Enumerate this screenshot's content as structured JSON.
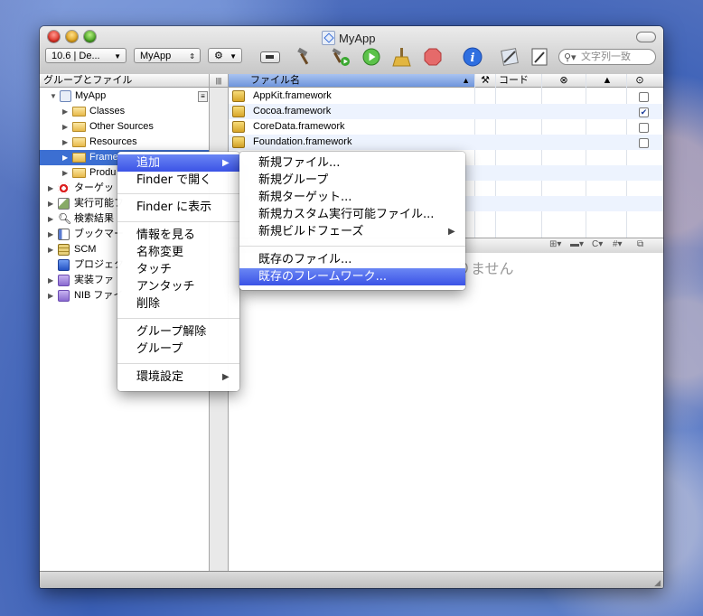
{
  "window": {
    "title": "MyApp"
  },
  "toolbar": {
    "sdk_popup": "10.6 | De...",
    "target_popup": "MyApp",
    "search_placeholder": "文字列一致"
  },
  "left_pane": {
    "header": "グループとファイル",
    "tree": [
      {
        "label": "MyApp"
      },
      {
        "label": "Classes"
      },
      {
        "label": "Other Sources"
      },
      {
        "label": "Resources"
      },
      {
        "label": "Frame"
      },
      {
        "label": "Produ"
      },
      {
        "label": "ターゲッ"
      },
      {
        "label": "実行可能フ"
      },
      {
        "label": "検索結果"
      },
      {
        "label": "ブックマー"
      },
      {
        "label": "SCM"
      },
      {
        "label": "プロジェク"
      },
      {
        "label": "実装ファ"
      },
      {
        "label": "NIB ファイ"
      }
    ]
  },
  "file_list": {
    "col_name": "ファイル名",
    "col_code": "コード",
    "files": [
      {
        "name": "AppKit.framework",
        "checked": false
      },
      {
        "name": "Cocoa.framework",
        "checked": true
      },
      {
        "name": "CoreData.framework",
        "checked": false
      },
      {
        "name": "Foundation.framework",
        "checked": false
      }
    ]
  },
  "detail": {
    "message_fragment": "りません"
  },
  "context_menu": {
    "items": [
      "追加",
      "Finder で開く",
      "Finder に表示",
      "情報を見る",
      "名称変更",
      "タッチ",
      "アンタッチ",
      "削除",
      "グループ解除",
      "グループ",
      "環境設定"
    ]
  },
  "submenu": {
    "items": [
      "新規ファイル...",
      "新規グループ",
      "新規ターゲット...",
      "新規カスタム実行可能ファイル...",
      "新規ビルドフェーズ",
      "既存のファイル...",
      "既存のフレームワーク..."
    ]
  }
}
